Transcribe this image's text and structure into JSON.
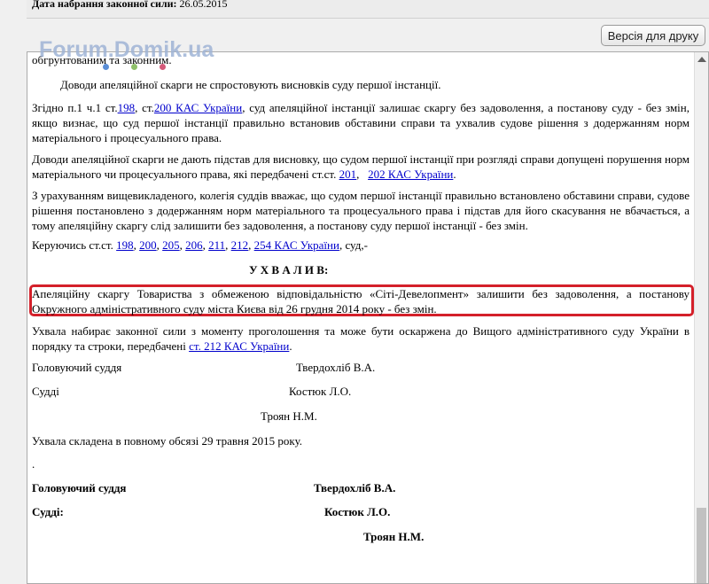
{
  "topbar": {
    "label": "Дата набрання законної сили:",
    "value": "26.05.2015"
  },
  "print_button": "Версія для друку",
  "watermark": "Forum.Domik.ua",
  "colors": {
    "highlight": "#d4202a",
    "link": "#0000cc",
    "dots": [
      "#5b8ed6",
      "#8fc06a",
      "#d45a7a"
    ]
  },
  "doc": {
    "p0": "обгрунтованим та законним.",
    "p1": "Доводи апеляційної скарги не спростовують висновків суду першої інстанції.",
    "p2_a": "Згідно п.1 ч.1 ст.",
    "p2_l1": "198",
    "p2_b": ", ст.",
    "p2_l2": "200 КАС України",
    "p2_c": ", суд апеляційної інстанції залишає скаргу без задоволення, а постанову суду - без змін, якщо визнає, що суд першої інстанції правильно встановив обставини справи та ухвалив судове рішення з додержанням норм матеріального і процесуального права.",
    "p3_a": "Доводи апеляційної скарги не дають підстав для висновку, що судом першої інстанції при розгляді справи допущені порушення норм матеріального чи процесуального права, які передбачені ст.ст. ",
    "p3_l1": "201",
    "p3_b": ",   ",
    "p3_l2": "202 КАС України",
    "p3_c": ".",
    "p4": "З урахуванням вищевикладеного, колегія суддів вважає, що судом першої інстанції правильно встановлено обставини справи, судове рішення постановлено з додержанням норм матеріального та процесуального права і підстав для його скасування не вбачається, а тому апеляційну скаргу слід залишити без задоволення, а постанову суду першої інстанції - без змін.",
    "p5_a": "Керуючись ст.ст. ",
    "p5_l1": "198",
    "p5_l2": "200",
    "p5_l3": "205",
    "p5_l4": "206",
    "p5_l5": "211",
    "p5_l6": "212",
    "p5_l7": "254 КАС України",
    "p5_c": ",  суд,-",
    "heading": "У Х В А Л И В:",
    "p6": "Апеляційну скаргу Товариства з обмеженою відповідальністю «Сіті-Девелопмент» залишити без задоволення, а постанову Окружного адміністративного суду міста Києва  від 26 грудня 2014 року - без змін.",
    "p7_a": "Ухвала набирає законної сили з моменту проголошення та може бути оскаржена до Вищого адміністративного суду України в порядку та строки, передбачені ",
    "p7_l1": "ст. 212 КАС України",
    "p7_c": ".",
    "presiding_label": "Головуючий суддя",
    "presiding_name": "Твердохліб В.А.",
    "judges_label": "Судді",
    "judge1": "Костюк Л.О.",
    "judge2": "Троян Н.М.",
    "composed": "Ухвала складена в повному обсязі 29 травня 2015 року.",
    "dot": ".",
    "b_presiding_label": "Головуючий суддя",
    "b_presiding_name": "Твердохліб В.А.",
    "b_judges_label": "Судді:",
    "b_judge1": "Костюк Л.О.",
    "b_judge2": "Троян Н.М."
  }
}
